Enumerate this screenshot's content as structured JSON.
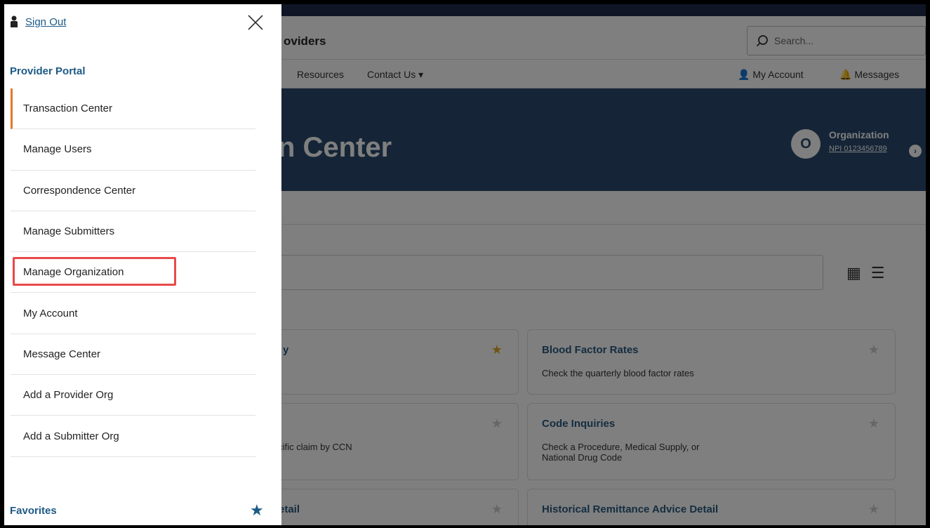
{
  "drawer": {
    "sign_out": "Sign Out",
    "portal_title": "Provider Portal",
    "items": [
      {
        "label": "Transaction Center",
        "active": true
      },
      {
        "label": "Manage Users"
      },
      {
        "label": "Correspondence Center"
      },
      {
        "label": "Manage Submitters"
      },
      {
        "label": "Manage Organization"
      },
      {
        "label": "My Account"
      },
      {
        "label": "Message Center"
      },
      {
        "label": "Add a Provider Org"
      },
      {
        "label": "Add a Submitter Org"
      }
    ],
    "favorites": "Favorites",
    "highlight_color": "#e84a4a",
    "active_color": "#e07a2c"
  },
  "page": {
    "brand_fragment": "oviders",
    "search_placeholder": "Search...",
    "nav": {
      "resources": "Resources",
      "contact": "Contact Us",
      "my_account": "My Account",
      "messages": "Messages"
    },
    "hero_title_fragment": "n Center",
    "org": {
      "initial": "O",
      "title": "Organization",
      "npi": "NPI 0123456789"
    },
    "cards": [
      {
        "title": "y",
        "desc": "",
        "starred": true
      },
      {
        "title": "Blood Factor Rates",
        "desc": "Check the quarterly blood factor rates",
        "starred": false
      },
      {
        "title": "",
        "desc": "ecific claim by CCN",
        "starred": false
      },
      {
        "title": "Code Inquiries",
        "desc": "Check a Procedure, Medical Supply, or National Drug Code",
        "starred": false
      },
      {
        "title": "etail",
        "desc": "",
        "starred": false
      },
      {
        "title": "Historical Remittance Advice Detail",
        "desc": "",
        "starred": false
      }
    ],
    "hero_color": "#2a4a6e"
  }
}
